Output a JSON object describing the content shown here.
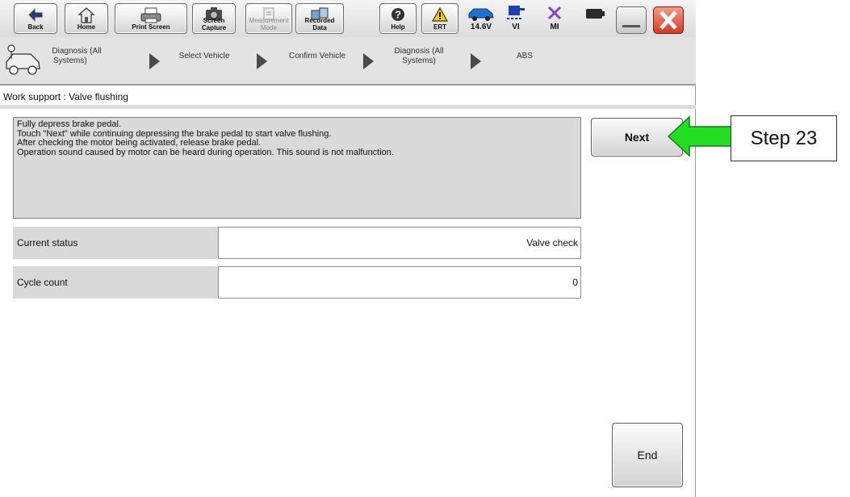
{
  "toolbar": {
    "back": "Back",
    "home": "Home",
    "print_screen": "Print Screen",
    "screen_capture_1": "Screen",
    "screen_capture_2": "Capture",
    "measurement_1": "Measurement",
    "measurement_2": "Mode",
    "recorded_1": "Recorded",
    "recorded_2": "Data",
    "help": "Help",
    "ert": "ERT",
    "voltage": "14.6V",
    "vi": "VI",
    "mi": "MI"
  },
  "breadcrumb": {
    "items": [
      {
        "line1": "Diagnosis (All",
        "line2": "Systems)"
      },
      {
        "line1": "Select Vehicle"
      },
      {
        "line1": "Confirm Vehicle"
      },
      {
        "line1": "Diagnosis (All",
        "line2": "Systems)"
      },
      {
        "line1": "ABS"
      }
    ]
  },
  "page": {
    "title": "Work support : Valve flushing"
  },
  "instructions": [
    "Fully depress brake pedal.",
    "Touch \"Next\" while continuing depressing the brake pedal to start valve flushing.",
    "After checking the motor being activated, release brake pedal.",
    "Operation sound caused by motor can be heard during operation. This sound is not malfunction."
  ],
  "status": {
    "current_label": "Current status",
    "current_value": "Valve check",
    "cycle_label": "Cycle count",
    "cycle_value": "0"
  },
  "buttons": {
    "next": "Next",
    "end": "End"
  },
  "callout": {
    "text": "Step 23",
    "arrow_color": "#22dd22"
  },
  "icons": {
    "back": "left-arrow-icon",
    "home": "house-icon",
    "print": "printer-icon",
    "capture": "camera-icon",
    "measurement": "gauge-icon",
    "recorded": "data-icon",
    "help": "question-icon",
    "ert": "warning-icon",
    "battery_car": "car-icon",
    "vi": "vi-icon",
    "mi": "mi-cross-icon",
    "battery": "battery-icon",
    "breadcrumb_car": "vehicle-icon"
  }
}
